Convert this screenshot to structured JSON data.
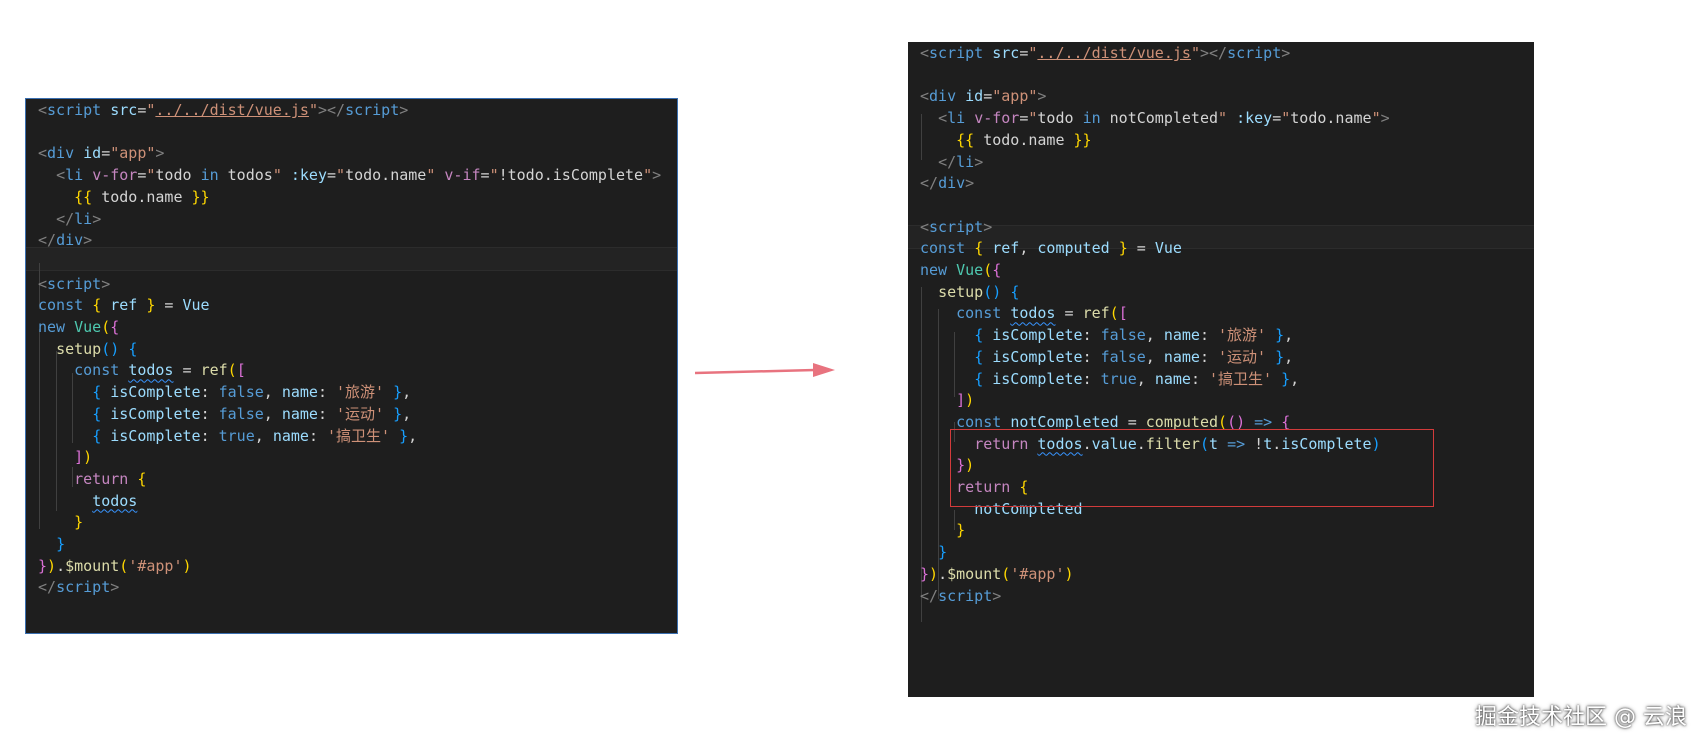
{
  "left_code": {
    "lines": [
      [
        [
          "t-tag",
          "<"
        ],
        [
          "t-name",
          "script"
        ],
        [
          "t-txt",
          " "
        ],
        [
          "t-attr",
          "src"
        ],
        [
          "t-txt",
          "="
        ],
        [
          "t-str",
          "\""
        ],
        [
          "t-link",
          "../../dist/vue.js"
        ],
        [
          "t-str",
          "\""
        ],
        [
          "t-tag",
          "></"
        ],
        [
          "t-name",
          "script"
        ],
        [
          "t-tag",
          ">"
        ]
      ],
      [],
      [
        [
          "t-tag",
          "<"
        ],
        [
          "t-name",
          "div"
        ],
        [
          "t-txt",
          " "
        ],
        [
          "t-attr",
          "id"
        ],
        [
          "t-txt",
          "="
        ],
        [
          "t-str",
          "\"app\""
        ],
        [
          "t-tag",
          ">"
        ]
      ],
      [
        [
          "t-txt",
          "  "
        ],
        [
          "t-tag",
          "<"
        ],
        [
          "t-name",
          "li"
        ],
        [
          "t-txt",
          " "
        ],
        [
          "t-dir",
          "v-for"
        ],
        [
          "t-txt",
          "="
        ],
        [
          "t-str",
          "\""
        ],
        [
          "t-txt",
          "todo "
        ],
        [
          "t-kw",
          "in"
        ],
        [
          "t-txt",
          " todos"
        ],
        [
          "t-str",
          "\""
        ],
        [
          "t-txt",
          " "
        ],
        [
          "t-attr",
          ":key"
        ],
        [
          "t-txt",
          "="
        ],
        [
          "t-str",
          "\""
        ],
        [
          "t-txt",
          "todo.name"
        ],
        [
          "t-str",
          "\""
        ],
        [
          "t-txt",
          " "
        ],
        [
          "t-dir",
          "v-if"
        ],
        [
          "t-txt",
          "="
        ],
        [
          "t-str",
          "\""
        ],
        [
          "t-txt",
          "!todo.isComplete"
        ],
        [
          "t-str",
          "\""
        ],
        [
          "t-tag",
          ">"
        ]
      ],
      [
        [
          "t-txt",
          "    "
        ],
        [
          "t-b1",
          "{{"
        ],
        [
          "t-txt",
          " todo.name "
        ],
        [
          "t-b1",
          "}}"
        ]
      ],
      [
        [
          "t-txt",
          "  "
        ],
        [
          "t-tag",
          "</"
        ],
        [
          "t-name",
          "li"
        ],
        [
          "t-tag",
          ">"
        ]
      ],
      [
        [
          "t-tag",
          "</"
        ],
        [
          "t-name",
          "div"
        ],
        [
          "t-tag",
          ">"
        ]
      ],
      [],
      [
        [
          "t-tag",
          "<"
        ],
        [
          "t-name",
          "script"
        ],
        [
          "t-tag",
          ">"
        ]
      ],
      [
        [
          "t-kw",
          "const"
        ],
        [
          "t-txt",
          " "
        ],
        [
          "t-b1",
          "{"
        ],
        [
          "t-txt",
          " "
        ],
        [
          "t-var",
          "ref"
        ],
        [
          "t-txt",
          " "
        ],
        [
          "t-b1",
          "}"
        ],
        [
          "t-txt",
          " = "
        ],
        [
          "t-var",
          "Vue"
        ]
      ],
      [
        [
          "t-kw",
          "new"
        ],
        [
          "t-txt",
          " "
        ],
        [
          "t-cls",
          "Vue"
        ],
        [
          "t-b1",
          "("
        ],
        [
          "t-b2",
          "{"
        ]
      ],
      [
        [
          "t-txt",
          "  "
        ],
        [
          "t-fn",
          "setup"
        ],
        [
          "t-b3",
          "()"
        ],
        [
          "t-txt",
          " "
        ],
        [
          "t-b3",
          "{"
        ]
      ],
      [
        [
          "t-txt",
          "    "
        ],
        [
          "t-kw",
          "const"
        ],
        [
          "t-txt",
          " "
        ],
        [
          "t-var squig",
          "todos"
        ],
        [
          "t-txt",
          " = "
        ],
        [
          "t-fn",
          "ref"
        ],
        [
          "t-b1",
          "("
        ],
        [
          "t-b2",
          "["
        ]
      ],
      [
        [
          "t-txt",
          "      "
        ],
        [
          "t-b3",
          "{"
        ],
        [
          "t-txt",
          " "
        ],
        [
          "t-var",
          "isComplete"
        ],
        [
          "t-txt",
          ": "
        ],
        [
          "t-kw",
          "false"
        ],
        [
          "t-txt",
          ", "
        ],
        [
          "t-var",
          "name"
        ],
        [
          "t-txt",
          ": "
        ],
        [
          "t-str",
          "'旅游'"
        ],
        [
          "t-txt",
          " "
        ],
        [
          "t-b3",
          "}"
        ],
        [
          "t-txt",
          ","
        ]
      ],
      [
        [
          "t-txt",
          "      "
        ],
        [
          "t-b3",
          "{"
        ],
        [
          "t-txt",
          " "
        ],
        [
          "t-var",
          "isComplete"
        ],
        [
          "t-txt",
          ": "
        ],
        [
          "t-kw",
          "false"
        ],
        [
          "t-txt",
          ", "
        ],
        [
          "t-var",
          "name"
        ],
        [
          "t-txt",
          ": "
        ],
        [
          "t-str",
          "'运动'"
        ],
        [
          "t-txt",
          " "
        ],
        [
          "t-b3",
          "}"
        ],
        [
          "t-txt",
          ","
        ]
      ],
      [
        [
          "t-txt",
          "      "
        ],
        [
          "t-b3",
          "{"
        ],
        [
          "t-txt",
          " "
        ],
        [
          "t-var",
          "isComplete"
        ],
        [
          "t-txt",
          ": "
        ],
        [
          "t-kw",
          "true"
        ],
        [
          "t-txt",
          ", "
        ],
        [
          "t-var",
          "name"
        ],
        [
          "t-txt",
          ": "
        ],
        [
          "t-str",
          "'搞卫生'"
        ],
        [
          "t-txt",
          " "
        ],
        [
          "t-b3",
          "}"
        ],
        [
          "t-txt",
          ","
        ]
      ],
      [
        [
          "t-txt",
          "    "
        ],
        [
          "t-b2",
          "]"
        ],
        [
          "t-b1",
          ")"
        ]
      ],
      [
        [
          "t-txt",
          "    "
        ],
        [
          "t-ctl",
          "return"
        ],
        [
          "t-txt",
          " "
        ],
        [
          "t-b1",
          "{"
        ]
      ],
      [
        [
          "t-txt",
          "      "
        ],
        [
          "t-var squig",
          "todos"
        ]
      ],
      [
        [
          "t-txt",
          "    "
        ],
        [
          "t-b1",
          "}"
        ]
      ],
      [
        [
          "t-txt",
          "  "
        ],
        [
          "t-b3",
          "}"
        ]
      ],
      [
        [
          "t-b2",
          "}"
        ],
        [
          "t-b1",
          ")"
        ],
        [
          "t-txt",
          "."
        ],
        [
          "t-fn",
          "$mount"
        ],
        [
          "t-b1",
          "("
        ],
        [
          "t-str",
          "'#app'"
        ],
        [
          "t-b1",
          ")"
        ]
      ],
      [
        [
          "t-tag",
          "</"
        ],
        [
          "t-name",
          "script"
        ],
        [
          "t-tag",
          ">"
        ]
      ]
    ]
  },
  "right_code": {
    "lines": [
      [
        [
          "t-tag",
          "<"
        ],
        [
          "t-name",
          "script"
        ],
        [
          "t-txt",
          " "
        ],
        [
          "t-attr",
          "src"
        ],
        [
          "t-txt",
          "="
        ],
        [
          "t-str",
          "\""
        ],
        [
          "t-link",
          "../../dist/vue.js"
        ],
        [
          "t-str",
          "\""
        ],
        [
          "t-tag",
          "></"
        ],
        [
          "t-name",
          "script"
        ],
        [
          "t-tag",
          ">"
        ]
      ],
      [],
      [
        [
          "t-tag",
          "<"
        ],
        [
          "t-name",
          "div"
        ],
        [
          "t-txt",
          " "
        ],
        [
          "t-attr",
          "id"
        ],
        [
          "t-txt",
          "="
        ],
        [
          "t-str",
          "\"app\""
        ],
        [
          "t-tag",
          ">"
        ]
      ],
      [
        [
          "t-txt",
          "  "
        ],
        [
          "t-tag",
          "<"
        ],
        [
          "t-name",
          "li"
        ],
        [
          "t-txt",
          " "
        ],
        [
          "t-dir",
          "v-for"
        ],
        [
          "t-txt",
          "="
        ],
        [
          "t-str",
          "\""
        ],
        [
          "t-txt",
          "todo "
        ],
        [
          "t-kw",
          "in"
        ],
        [
          "t-txt",
          " notCompleted"
        ],
        [
          "t-str",
          "\""
        ],
        [
          "t-txt",
          " "
        ],
        [
          "t-attr",
          ":key"
        ],
        [
          "t-txt",
          "="
        ],
        [
          "t-str",
          "\""
        ],
        [
          "t-txt",
          "todo.name"
        ],
        [
          "t-str",
          "\""
        ],
        [
          "t-tag",
          ">"
        ]
      ],
      [
        [
          "t-txt",
          "    "
        ],
        [
          "t-b1",
          "{{"
        ],
        [
          "t-txt",
          " todo.name "
        ],
        [
          "t-b1",
          "}}"
        ]
      ],
      [
        [
          "t-txt",
          "  "
        ],
        [
          "t-tag",
          "</"
        ],
        [
          "t-name",
          "li"
        ],
        [
          "t-tag",
          ">"
        ]
      ],
      [
        [
          "t-tag",
          "</"
        ],
        [
          "t-name",
          "div"
        ],
        [
          "t-tag",
          ">"
        ]
      ],
      [],
      [
        [
          "t-tag",
          "<"
        ],
        [
          "t-name",
          "script"
        ],
        [
          "t-tag",
          ">"
        ]
      ],
      [
        [
          "t-kw",
          "const"
        ],
        [
          "t-txt",
          " "
        ],
        [
          "t-b1",
          "{"
        ],
        [
          "t-txt",
          " "
        ],
        [
          "t-var",
          "ref"
        ],
        [
          "t-txt",
          ", "
        ],
        [
          "t-var",
          "computed"
        ],
        [
          "t-txt",
          " "
        ],
        [
          "t-b1",
          "}"
        ],
        [
          "t-txt",
          " = "
        ],
        [
          "t-var",
          "Vue"
        ]
      ],
      [
        [
          "t-kw",
          "new"
        ],
        [
          "t-txt",
          " "
        ],
        [
          "t-cls",
          "Vue"
        ],
        [
          "t-b1",
          "("
        ],
        [
          "t-b2",
          "{"
        ]
      ],
      [
        [
          "t-txt",
          "  "
        ],
        [
          "t-fn",
          "setup"
        ],
        [
          "t-b3",
          "()"
        ],
        [
          "t-txt",
          " "
        ],
        [
          "t-b3",
          "{"
        ]
      ],
      [
        [
          "t-txt",
          "    "
        ],
        [
          "t-kw",
          "const"
        ],
        [
          "t-txt",
          " "
        ],
        [
          "t-var squig",
          "todos"
        ],
        [
          "t-txt",
          " = "
        ],
        [
          "t-fn",
          "ref"
        ],
        [
          "t-b1",
          "("
        ],
        [
          "t-b2",
          "["
        ]
      ],
      [
        [
          "t-txt",
          "      "
        ],
        [
          "t-b3",
          "{"
        ],
        [
          "t-txt",
          " "
        ],
        [
          "t-var",
          "isComplete"
        ],
        [
          "t-txt",
          ": "
        ],
        [
          "t-kw",
          "false"
        ],
        [
          "t-txt",
          ", "
        ],
        [
          "t-var",
          "name"
        ],
        [
          "t-txt",
          ": "
        ],
        [
          "t-str",
          "'旅游'"
        ],
        [
          "t-txt",
          " "
        ],
        [
          "t-b3",
          "}"
        ],
        [
          "t-txt",
          ","
        ]
      ],
      [
        [
          "t-txt",
          "      "
        ],
        [
          "t-b3",
          "{"
        ],
        [
          "t-txt",
          " "
        ],
        [
          "t-var",
          "isComplete"
        ],
        [
          "t-txt",
          ": "
        ],
        [
          "t-kw",
          "false"
        ],
        [
          "t-txt",
          ", "
        ],
        [
          "t-var",
          "name"
        ],
        [
          "t-txt",
          ": "
        ],
        [
          "t-str",
          "'运动'"
        ],
        [
          "t-txt",
          " "
        ],
        [
          "t-b3",
          "}"
        ],
        [
          "t-txt",
          ","
        ]
      ],
      [
        [
          "t-txt",
          "      "
        ],
        [
          "t-b3",
          "{"
        ],
        [
          "t-txt",
          " "
        ],
        [
          "t-var",
          "isComplete"
        ],
        [
          "t-txt",
          ": "
        ],
        [
          "t-kw",
          "true"
        ],
        [
          "t-txt",
          ", "
        ],
        [
          "t-var",
          "name"
        ],
        [
          "t-txt",
          ": "
        ],
        [
          "t-str",
          "'搞卫生'"
        ],
        [
          "t-txt",
          " "
        ],
        [
          "t-b3",
          "}"
        ],
        [
          "t-txt",
          ","
        ]
      ],
      [
        [
          "t-txt",
          "    "
        ],
        [
          "t-b2",
          "]"
        ],
        [
          "t-b1",
          ")"
        ]
      ],
      [
        [
          "t-txt",
          "    "
        ],
        [
          "t-kw",
          "const"
        ],
        [
          "t-txt",
          " "
        ],
        [
          "t-var",
          "notCompleted"
        ],
        [
          "t-txt",
          " = "
        ],
        [
          "t-fn",
          "computed"
        ],
        [
          "t-b1",
          "("
        ],
        [
          "t-b2",
          "()"
        ],
        [
          "t-txt",
          " "
        ],
        [
          "t-kw",
          "=>"
        ],
        [
          "t-txt",
          " "
        ],
        [
          "t-b2",
          "{"
        ]
      ],
      [
        [
          "t-txt",
          "      "
        ],
        [
          "t-ctl",
          "return"
        ],
        [
          "t-txt",
          " "
        ],
        [
          "t-var squig",
          "todos"
        ],
        [
          "t-txt",
          "."
        ],
        [
          "t-var",
          "value"
        ],
        [
          "t-txt",
          "."
        ],
        [
          "t-fn",
          "filter"
        ],
        [
          "t-b3",
          "("
        ],
        [
          "t-var",
          "t"
        ],
        [
          "t-txt",
          " "
        ],
        [
          "t-kw",
          "=>"
        ],
        [
          "t-txt",
          " !"
        ],
        [
          "t-var",
          "t"
        ],
        [
          "t-txt",
          "."
        ],
        [
          "t-var",
          "isComplete"
        ],
        [
          "t-b3",
          ")"
        ]
      ],
      [
        [
          "t-txt",
          "    "
        ],
        [
          "t-b2",
          "}"
        ],
        [
          "t-b1",
          ")"
        ]
      ],
      [
        [
          "t-txt",
          "    "
        ],
        [
          "t-ctl",
          "return"
        ],
        [
          "t-txt",
          " "
        ],
        [
          "t-b1",
          "{"
        ]
      ],
      [
        [
          "t-txt",
          "      "
        ],
        [
          "t-var",
          "notCompleted"
        ]
      ],
      [
        [
          "t-txt",
          "    "
        ],
        [
          "t-b1",
          "}"
        ]
      ],
      [
        [
          "t-txt",
          "  "
        ],
        [
          "t-b3",
          "}"
        ]
      ],
      [
        [
          "t-b2",
          "}"
        ],
        [
          "t-b1",
          ")"
        ],
        [
          "t-txt",
          "."
        ],
        [
          "t-fn",
          "$mount"
        ],
        [
          "t-b1",
          "("
        ],
        [
          "t-str",
          "'#app'"
        ],
        [
          "t-b1",
          ")"
        ]
      ],
      [
        [
          "t-tag",
          "</"
        ],
        [
          "t-name",
          "script"
        ],
        [
          "t-tag",
          ">"
        ]
      ]
    ]
  },
  "watermark": "掘金技术社区 @ 云浪",
  "colors": {
    "editor_bg": "#1e1e1e",
    "arrow": "#e8737f",
    "highlight_box": "#d23b3b"
  }
}
